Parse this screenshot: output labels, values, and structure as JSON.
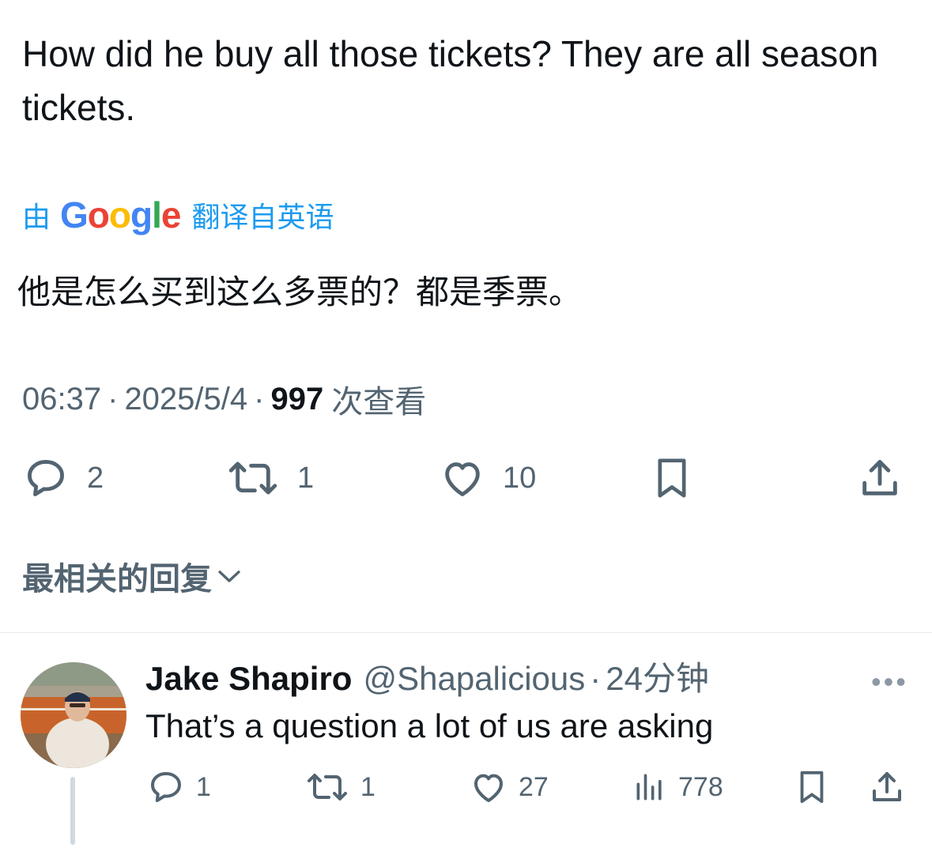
{
  "tweet": {
    "text": "How did he buy all those tickets? They are all season tickets.",
    "translate": {
      "prefix": "由",
      "provider": [
        "G",
        "o",
        "o",
        "g",
        "l",
        "e"
      ],
      "provider_colors": [
        "#4285F4",
        "#EA4335",
        "#FBBC05",
        "#4285F4",
        "#34A853",
        "#EA4335"
      ],
      "suffix": "翻译自英语"
    },
    "translated_text": "他是怎么买到这么多票的？都是季票。",
    "time": "06:37",
    "date": "2025/5/4",
    "views_count": "997",
    "views_label": "次查看",
    "separator": "·",
    "actions": {
      "reply_count": "2",
      "retweet_count": "1",
      "like_count": "10"
    }
  },
  "sort_label": "最相关的回复",
  "reply": {
    "name": "Jake Shapiro",
    "handle": "@Shapalicious",
    "dot": "·",
    "time": "24分钟",
    "text": "That’s a question a lot of us are asking",
    "more": "•••",
    "actions": {
      "reply_count": "1",
      "retweet_count": "1",
      "like_count": "27",
      "views_count": "778"
    }
  },
  "colors": {
    "text": "#0f1419",
    "secondary": "#536471",
    "link": "#1d9bf0",
    "divider": "#e6e9eb"
  }
}
